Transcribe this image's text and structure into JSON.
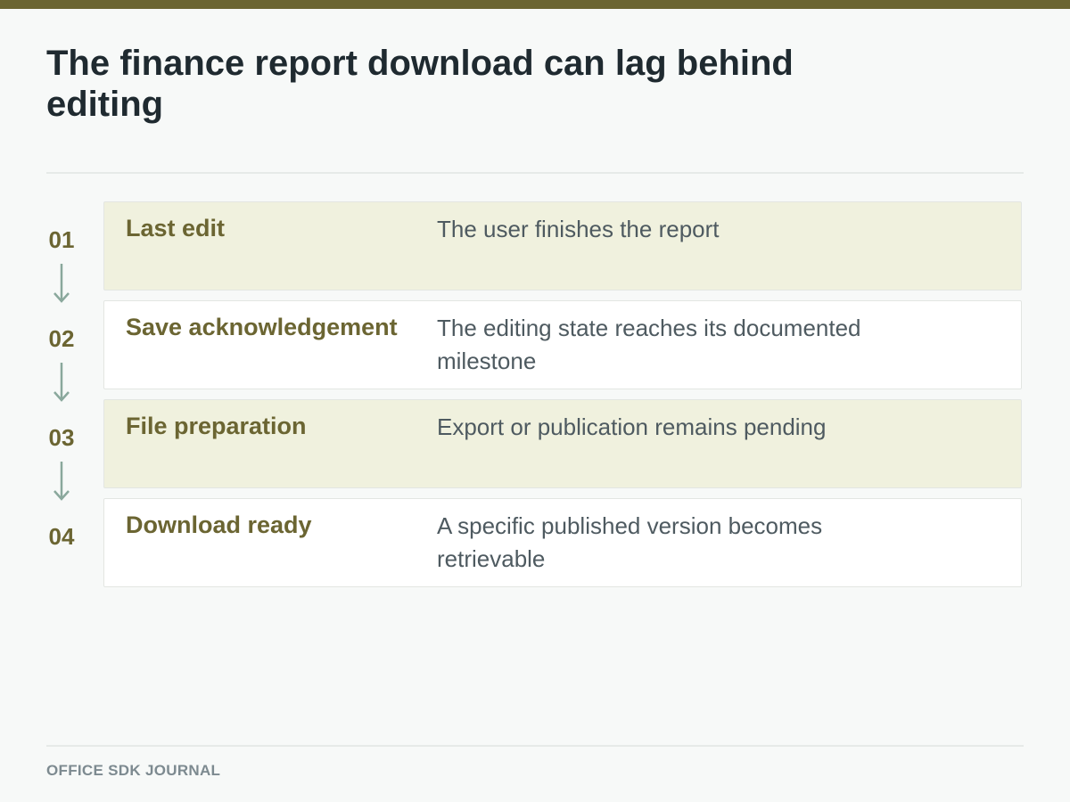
{
  "title": "The finance report download can lag behind editing",
  "steps": [
    {
      "number": "01",
      "title": "Last edit",
      "description": "The user finishes the report"
    },
    {
      "number": "02",
      "title": "Save acknowledgement",
      "description": "The editing state reaches its documented milestone"
    },
    {
      "number": "03",
      "title": "File preparation",
      "description": "Export or publication remains pending"
    },
    {
      "number": "04",
      "title": "Download ready",
      "description": "A specific published version becomes retrievable"
    }
  ],
  "footer": "OFFICE SDK JOURNAL",
  "colors": {
    "accent": "#6b6532",
    "shaded_card": "#f0f1de",
    "arrow": "#8aa89c"
  }
}
